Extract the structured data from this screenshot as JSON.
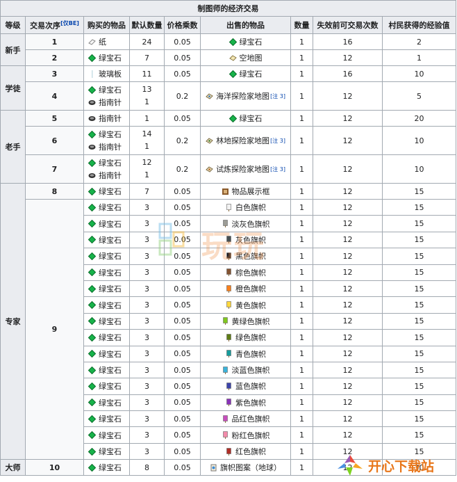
{
  "title": "制图师的经济交易",
  "headers": {
    "level": "等级",
    "order": "交易次序",
    "order_note": "[仅BE]",
    "buy": "购买的物品",
    "default_qty": "默认数量",
    "price_mult": "价格乘数",
    "sell": "出售的物品",
    "qty": "数量",
    "max_uses": "失效前可交易次数",
    "xp": "村民获得的经验值"
  },
  "levels": {
    "novice": "新手",
    "apprentice": "学徒",
    "journeyman": "老手",
    "expert": "专家",
    "master": "大师"
  },
  "trades": {
    "t1": {
      "order": "1",
      "buy": "纸",
      "buy_qty": "24",
      "mult": "0.05",
      "sell": "绿宝石",
      "qty": "1",
      "uses": "16",
      "xp": "2"
    },
    "t2": {
      "order": "2",
      "buy": "绿宝石",
      "buy_qty": "7",
      "mult": "0.05",
      "sell": "空地图",
      "qty": "1",
      "uses": "12",
      "xp": "1"
    },
    "t3": {
      "order": "3",
      "buy": "玻璃板",
      "buy_qty": "11",
      "mult": "0.05",
      "sell": "绿宝石",
      "qty": "1",
      "uses": "16",
      "xp": "10"
    },
    "t4": {
      "order": "4",
      "buy": "绿宝石",
      "buy_qty": "13",
      "buy2": "指南针",
      "buy2_qty": "1",
      "mult": "0.2",
      "sell": "海洋探险家地图",
      "note": "[注 3]",
      "qty": "1",
      "uses": "12",
      "xp": "5"
    },
    "t5": {
      "order": "5",
      "buy": "指南针",
      "buy_qty": "1",
      "mult": "0.05",
      "sell": "绿宝石",
      "qty": "1",
      "uses": "12",
      "xp": "20"
    },
    "t6": {
      "order": "6",
      "buy": "绿宝石",
      "buy_qty": "14",
      "buy2": "指南针",
      "buy2_qty": "1",
      "mult": "0.2",
      "sell": "林地探险家地图",
      "note": "[注 3]",
      "qty": "1",
      "uses": "12",
      "xp": "10"
    },
    "t7": {
      "order": "7",
      "buy": "绿宝石",
      "buy_qty": "12",
      "buy2": "指南针",
      "buy2_qty": "1",
      "mult": "0.2",
      "sell": "试炼探险家地图",
      "note": "[注 3]",
      "qty": "1",
      "uses": "12",
      "xp": "10"
    },
    "t8": {
      "order": "8",
      "buy": "绿宝石",
      "buy_qty": "7",
      "mult": "0.05",
      "sell": "物品展示框",
      "qty": "1",
      "uses": "12",
      "xp": "15"
    },
    "t9_order": "9",
    "t10": {
      "order": "10",
      "buy": "绿宝石",
      "buy_qty": "8",
      "mult": "0.05",
      "sell": "旗帜图案（地球）",
      "qty": "1",
      "uses": "12",
      "xp": "30"
    }
  },
  "banners": [
    {
      "buy": "绿宝石",
      "buy_qty": "3",
      "mult": "0.05",
      "sell": "白色旗帜",
      "qty": "1",
      "uses": "12",
      "xp": "15",
      "color": "#f2f2f2"
    },
    {
      "buy": "绿宝石",
      "buy_qty": "3",
      "mult": "0.05",
      "sell": "淡灰色旗帜",
      "qty": "1",
      "uses": "12",
      "xp": "15",
      "color": "#9d9d97"
    },
    {
      "buy": "绿宝石",
      "buy_qty": "3",
      "mult": "0.05",
      "sell": "灰色旗帜",
      "qty": "1",
      "uses": "12",
      "xp": "15",
      "color": "#474f52"
    },
    {
      "buy": "绿宝石",
      "buy_qty": "3",
      "mult": "0.05",
      "sell": "黑色旗帜",
      "qty": "1",
      "uses": "12",
      "xp": "15",
      "color": "#1d1d21"
    },
    {
      "buy": "绿宝石",
      "buy_qty": "3",
      "mult": "0.05",
      "sell": "棕色旗帜",
      "qty": "1",
      "uses": "12",
      "xp": "15",
      "color": "#835432"
    },
    {
      "buy": "绿宝石",
      "buy_qty": "3",
      "mult": "0.05",
      "sell": "橙色旗帜",
      "qty": "1",
      "uses": "12",
      "xp": "15",
      "color": "#f9801d"
    },
    {
      "buy": "绿宝石",
      "buy_qty": "3",
      "mult": "0.05",
      "sell": "黄色旗帜",
      "qty": "1",
      "uses": "12",
      "xp": "15",
      "color": "#fed83d"
    },
    {
      "buy": "绿宝石",
      "buy_qty": "3",
      "mult": "0.05",
      "sell": "黄绿色旗帜",
      "qty": "1",
      "uses": "12",
      "xp": "15",
      "color": "#80c71f"
    },
    {
      "buy": "绿宝石",
      "buy_qty": "3",
      "mult": "0.05",
      "sell": "绿色旗帜",
      "qty": "1",
      "uses": "12",
      "xp": "15",
      "color": "#5e7c16"
    },
    {
      "buy": "绿宝石",
      "buy_qty": "3",
      "mult": "0.05",
      "sell": "青色旗帜",
      "qty": "1",
      "uses": "12",
      "xp": "15",
      "color": "#169c9c"
    },
    {
      "buy": "绿宝石",
      "buy_qty": "3",
      "mult": "0.05",
      "sell": "淡蓝色旗帜",
      "qty": "1",
      "uses": "12",
      "xp": "15",
      "color": "#3ab3da"
    },
    {
      "buy": "绿宝石",
      "buy_qty": "3",
      "mult": "0.05",
      "sell": "蓝色旗帜",
      "qty": "1",
      "uses": "12",
      "xp": "15",
      "color": "#3c44aa"
    },
    {
      "buy": "绿宝石",
      "buy_qty": "3",
      "mult": "0.05",
      "sell": "紫色旗帜",
      "qty": "1",
      "uses": "12",
      "xp": "15",
      "color": "#8932b8"
    },
    {
      "buy": "绿宝石",
      "buy_qty": "3",
      "mult": "0.05",
      "sell": "品红色旗帜",
      "qty": "1",
      "uses": "12",
      "xp": "15",
      "color": "#c74ebd"
    },
    {
      "buy": "绿宝石",
      "buy_qty": "3",
      "mult": "0.05",
      "sell": "粉红色旗帜",
      "qty": "1",
      "uses": "12",
      "xp": "15",
      "color": "#f38baa"
    },
    {
      "buy": "绿宝石",
      "buy_qty": "3",
      "mult": "0.05",
      "sell": "红色旗帜",
      "qty": "1",
      "uses": "12",
      "xp": "15",
      "color": "#b02e26"
    }
  ],
  "colors": {
    "emerald": "#17b34a",
    "border": "#a2a9b1",
    "header_bg": "#eaecf0"
  },
  "watermark": {
    "text": "玩玩",
    "logo_text": "开心下载站"
  }
}
